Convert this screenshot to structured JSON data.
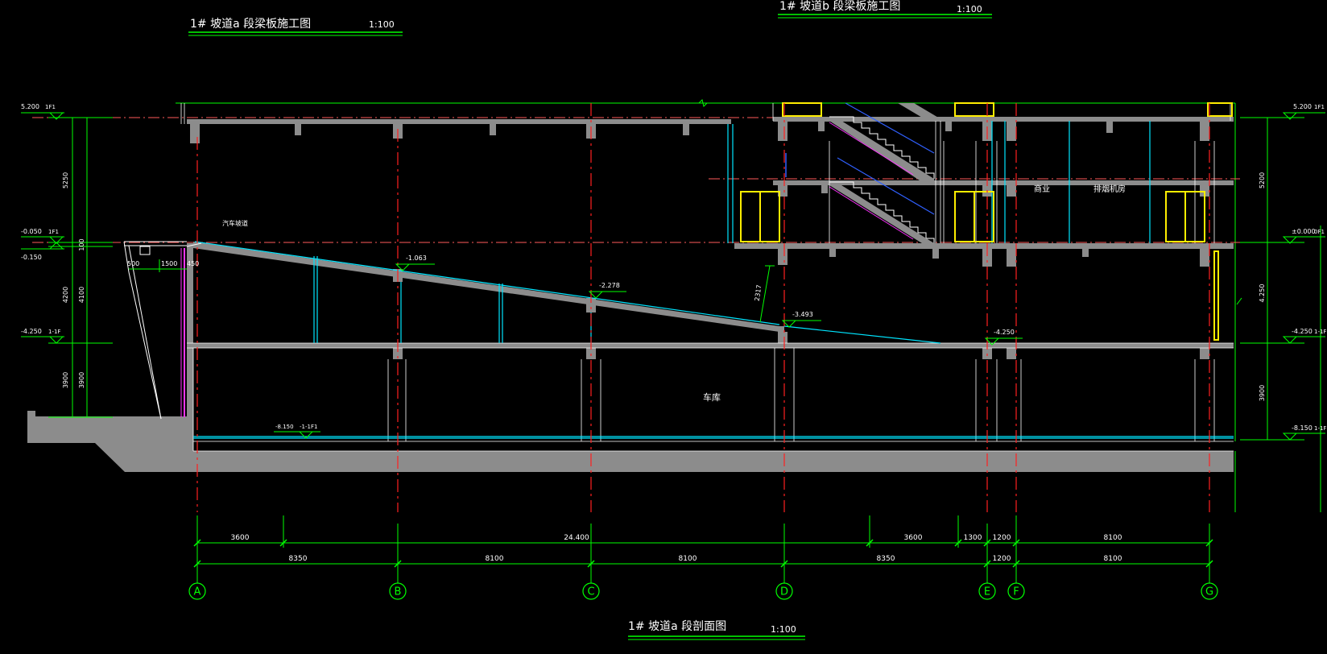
{
  "titles": {
    "plan_a": {
      "text": "1# 坡道a 段梁板施工图",
      "scale": "1:100"
    },
    "plan_b": {
      "text": "1# 坡道b 段梁板施工图",
      "scale": "1:100"
    },
    "section": {
      "text": "1# 坡道a 段剖面图",
      "scale": "1:100"
    }
  },
  "grid_axes": [
    "A",
    "B",
    "C",
    "D",
    "E",
    "F",
    "G"
  ],
  "dimensions": {
    "upper_row": [
      "3600",
      "24.400",
      "3600",
      "1300",
      "1200",
      "8100"
    ],
    "lower_row": [
      "8350",
      "8100",
      "8100",
      "8350",
      "1200",
      "8100"
    ]
  },
  "left_elevations": {
    "top": {
      "value": "5.200",
      "note": "1F1"
    },
    "ground": {
      "value": "-0.050",
      "note": "1F1"
    },
    "ground_sub": "-0.150",
    "mid": {
      "value": "-4.250",
      "note": "1-1F"
    }
  },
  "left_heights": [
    "5250",
    "100",
    "4200",
    "4100",
    "3900",
    "3900"
  ],
  "right_elevations": {
    "top": {
      "value": "5.200",
      "note": "1F1"
    },
    "ground": {
      "value": "±0.000",
      "note": "0F1"
    },
    "mid": {
      "value": "-4.250",
      "note": "1-1F"
    },
    "bottom": {
      "value": "-8.150",
      "note": "1-1F"
    }
  },
  "right_heights": [
    "5200",
    "4.250",
    "3900"
  ],
  "ramp_levels": [
    "-1.063",
    "-2.278",
    "-3.493",
    "-4.250"
  ],
  "floor_level": {
    "value": "-8.150",
    "note": "-1-1F1"
  },
  "room_labels": {
    "garage": "车库",
    "shop": "商业",
    "mech": "排烟机房",
    "entrance": "汽车坡道"
  },
  "small_dims": {
    "a": "500",
    "b": "1500",
    "c": "450",
    "clear_height": "2317"
  },
  "colors": {
    "line_green": "#00ff00",
    "axis_red": "#ff2020",
    "cyan": "#00e5ff",
    "slab_gray": "#8c8c8c",
    "magenta": "#ff33ff",
    "yellow": "#ffee00",
    "blue": "#3060ff"
  }
}
